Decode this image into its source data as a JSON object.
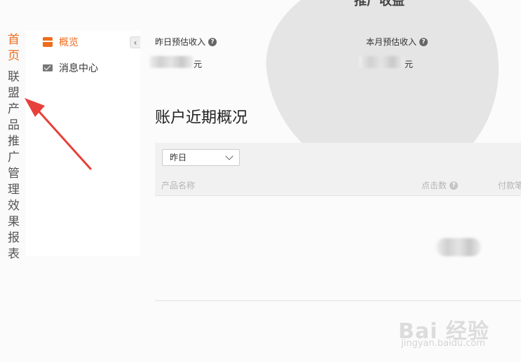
{
  "background": {
    "heading": "推广收益"
  },
  "main_nav": [
    {
      "label": "首页",
      "active": true
    },
    {
      "label": "联盟产品",
      "active": false
    },
    {
      "label": "推广管理",
      "active": false
    },
    {
      "label": "效果报表",
      "active": false
    }
  ],
  "sub_nav": [
    {
      "label": "概览",
      "icon": "card-icon",
      "active": true
    },
    {
      "label": "消息中心",
      "icon": "mail-icon",
      "active": false
    }
  ],
  "collapse_glyph": "‹",
  "stats": {
    "yesterday": {
      "label": "昨日预估收入",
      "unit": "元"
    },
    "month": {
      "label": "本月预估收入",
      "unit": "元"
    }
  },
  "section_title": "账户近期概况",
  "filter": {
    "selected": "昨日"
  },
  "table": {
    "columns": [
      "产品名称",
      "点击数",
      "付款笔"
    ]
  },
  "help_glyph": "?",
  "watermark": {
    "logo": "Bai 经验",
    "url": "jingyan.baidu.com"
  },
  "colors": {
    "accent": "#ef6c1c",
    "arrow": "#e8403a"
  }
}
